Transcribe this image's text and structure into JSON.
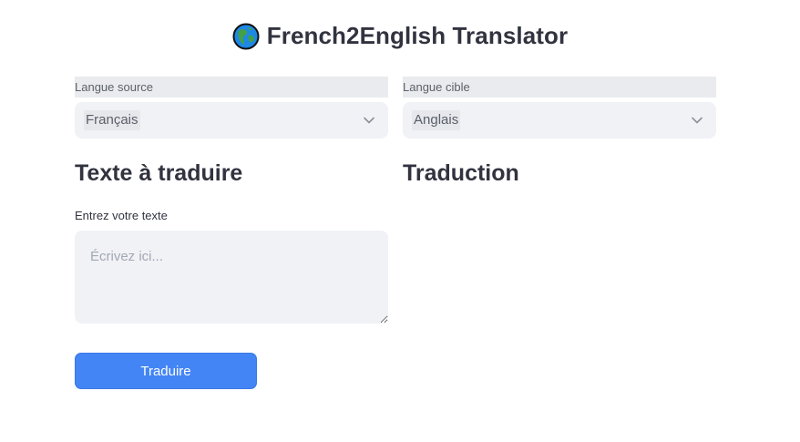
{
  "header": {
    "title": "French2English Translator",
    "icon": "globe-icon"
  },
  "source_select": {
    "label": "Langue source",
    "value": "Français",
    "icon": "chevron-down-icon"
  },
  "target_select": {
    "label": "Langue cible",
    "value": "Anglais",
    "icon": "chevron-down-icon"
  },
  "input_section": {
    "heading": "Texte à traduire",
    "field_label": "Entrez votre texte",
    "placeholder": "Écrivez ici..."
  },
  "output_section": {
    "heading": "Traduction"
  },
  "actions": {
    "translate_label": "Traduire"
  },
  "colors": {
    "primary_button": "#4385f5",
    "input_background": "#f0f2f6",
    "text": "#31333f"
  }
}
